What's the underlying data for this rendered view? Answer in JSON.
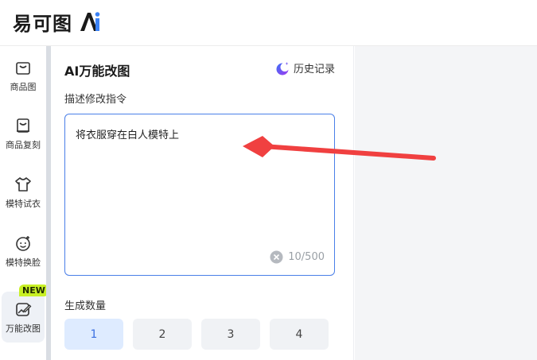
{
  "header": {
    "logo_text": "易可图",
    "logo_ai": "Ai"
  },
  "nav": [
    {
      "label": "商品图",
      "icon": "shopping-bag-icon"
    },
    {
      "label": "商品复刻",
      "icon": "bag-copy-icon"
    },
    {
      "label": "模特试衣",
      "icon": "tshirt-icon"
    },
    {
      "label": "模特换脸",
      "icon": "face-swap-icon"
    },
    {
      "label": "万能改图",
      "icon": "image-edit-icon",
      "badge": "NEW",
      "active": true
    }
  ],
  "panel": {
    "title": "AI万能改图",
    "history_label": "历史记录",
    "prompt_label": "描述修改指令",
    "prompt_value": "将衣服穿在白人模特上",
    "char_count": "10/500",
    "quantity_label": "生成数量",
    "quantity_options": [
      "1",
      "2",
      "3",
      "4"
    ],
    "quantity_selected": "1"
  },
  "colors": {
    "accent": "#4a7fe8",
    "badge": "#c8f025",
    "annotation": "#f04040"
  }
}
